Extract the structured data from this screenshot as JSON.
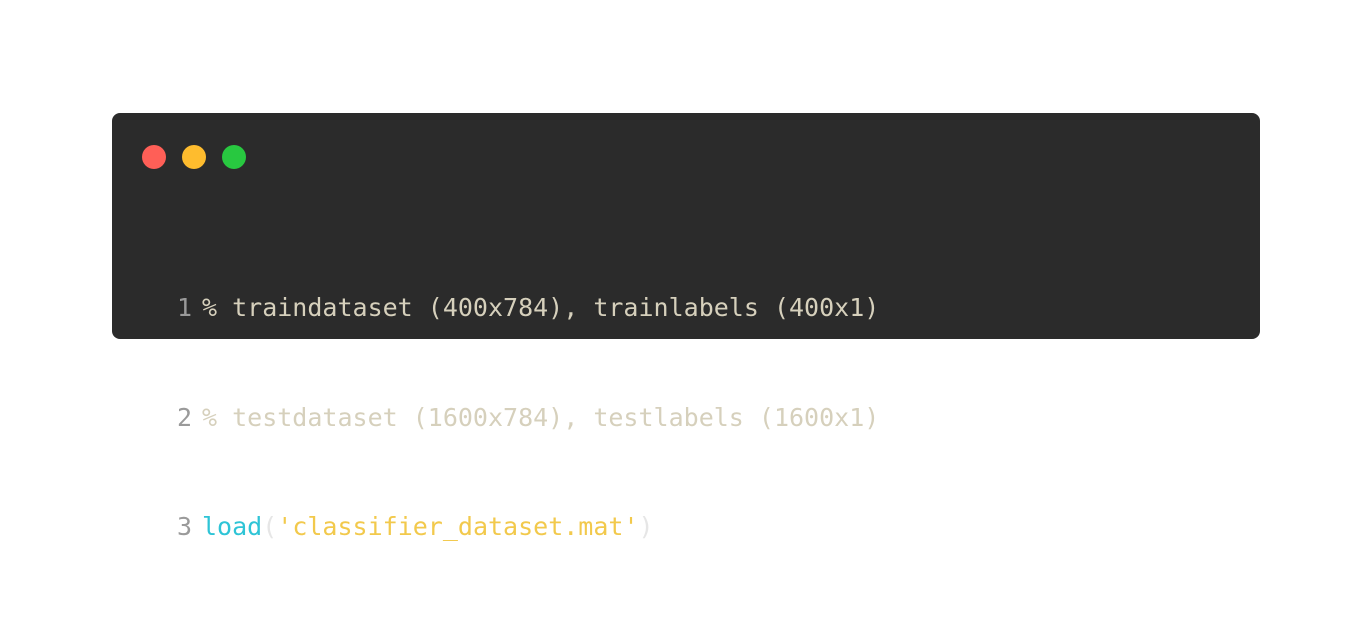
{
  "window": {
    "buttons": {
      "close_color": "#ff5f57",
      "minimize_color": "#febc2e",
      "maximize_color": "#28c840"
    },
    "background_color": "#2b2b2b"
  },
  "code": {
    "language": "matlab",
    "lines": [
      {
        "number": "1",
        "comment": "% traindataset (400x784), trainlabels (400x1)"
      },
      {
        "number": "2",
        "comment": "% testdataset (1600x784), testlabels (1600x1)"
      },
      {
        "number": "3",
        "func": "load",
        "open_paren": "(",
        "string": "'classifier_dataset.mat'",
        "close_paren": ")"
      }
    ]
  }
}
